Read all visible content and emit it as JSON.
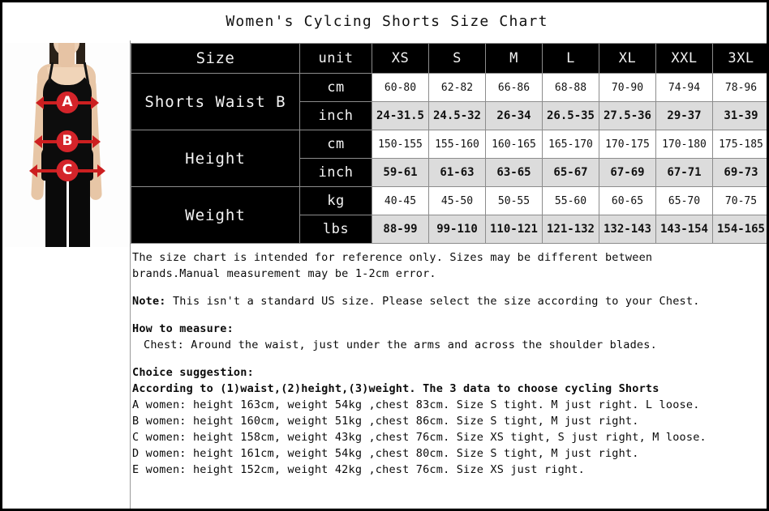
{
  "title": "Women's Cylcing Shorts Size Chart",
  "photo": {
    "alt_name": "woman-in-black-camisole-and-leggings",
    "markers": [
      {
        "label": "A",
        "meaning": "bust"
      },
      {
        "label": "B",
        "meaning": "waist"
      },
      {
        "label": "C",
        "meaning": "hips"
      }
    ],
    "marker_color": "#d4242a"
  },
  "table": {
    "header": {
      "size_label": "Size",
      "unit_label": "unit",
      "sizes": [
        "XS",
        "S",
        "M",
        "L",
        "XL",
        "XXL",
        "3XL"
      ]
    },
    "groups": [
      {
        "label": "Shorts Waist B",
        "rows": [
          {
            "unit": "cm",
            "values": [
              "60-80",
              "62-82",
              "66-86",
              "68-88",
              "70-90",
              "74-94",
              "78-96"
            ],
            "shaded": false
          },
          {
            "unit": "inch",
            "values": [
              "24-31.5",
              "24.5-32",
              "26-34",
              "26.5-35",
              "27.5-36",
              "29-37",
              "31-39"
            ],
            "shaded": true
          }
        ]
      },
      {
        "label": "Height",
        "rows": [
          {
            "unit": "cm",
            "values": [
              "150-155",
              "155-160",
              "160-165",
              "165-170",
              "170-175",
              "170-180",
              "175-185"
            ],
            "shaded": false
          },
          {
            "unit": "inch",
            "values": [
              "59-61",
              "61-63",
              "63-65",
              "65-67",
              "67-69",
              "67-71",
              "69-73"
            ],
            "shaded": true
          }
        ]
      },
      {
        "label": "Weight",
        "rows": [
          {
            "unit": "kg",
            "values": [
              "40-45",
              "45-50",
              "50-55",
              "55-60",
              "60-65",
              "65-70",
              "70-75"
            ],
            "shaded": false
          },
          {
            "unit": "lbs",
            "values": [
              "88-99",
              "99-110",
              "110-121",
              "121-132",
              "132-143",
              "143-154",
              "154-165"
            ],
            "shaded": true
          }
        ]
      }
    ]
  },
  "notes": {
    "disclaimer_line1": "The size chart is intended for reference only. Sizes may be different between",
    "disclaimer_line2": "brands.Manual measurement may be 1-2cm error.",
    "note_label": "Note:",
    "note_text": "This isn't a standard US size. Please select the size according to your Chest.",
    "how_to_measure_heading": "How to measure:",
    "how_to_measure_line": "Chest: Around the waist, just under the arms and across the shoulder blades.",
    "choice_heading": "Choice suggestion:",
    "choice_intro": "According to (1)waist,(2)height,(3)weight. The 3 data to choose cycling Shorts",
    "examples": [
      "A women: height 163cm, weight 54kg ,chest 83cm. Size S tight. M just right. L loose.",
      "B women: height 160cm, weight 51kg ,chest 86cm. Size S tight, M just right.",
      "C women: height 158cm, weight 43kg ,chest 76cm. Size XS tight, S just right, M loose.",
      "D women: height 161cm, weight 54kg ,chest 80cm. Size S tight, M just right.",
      "E women: height 152cm, weight 42kg ,chest 76cm. Size XS just right."
    ]
  }
}
